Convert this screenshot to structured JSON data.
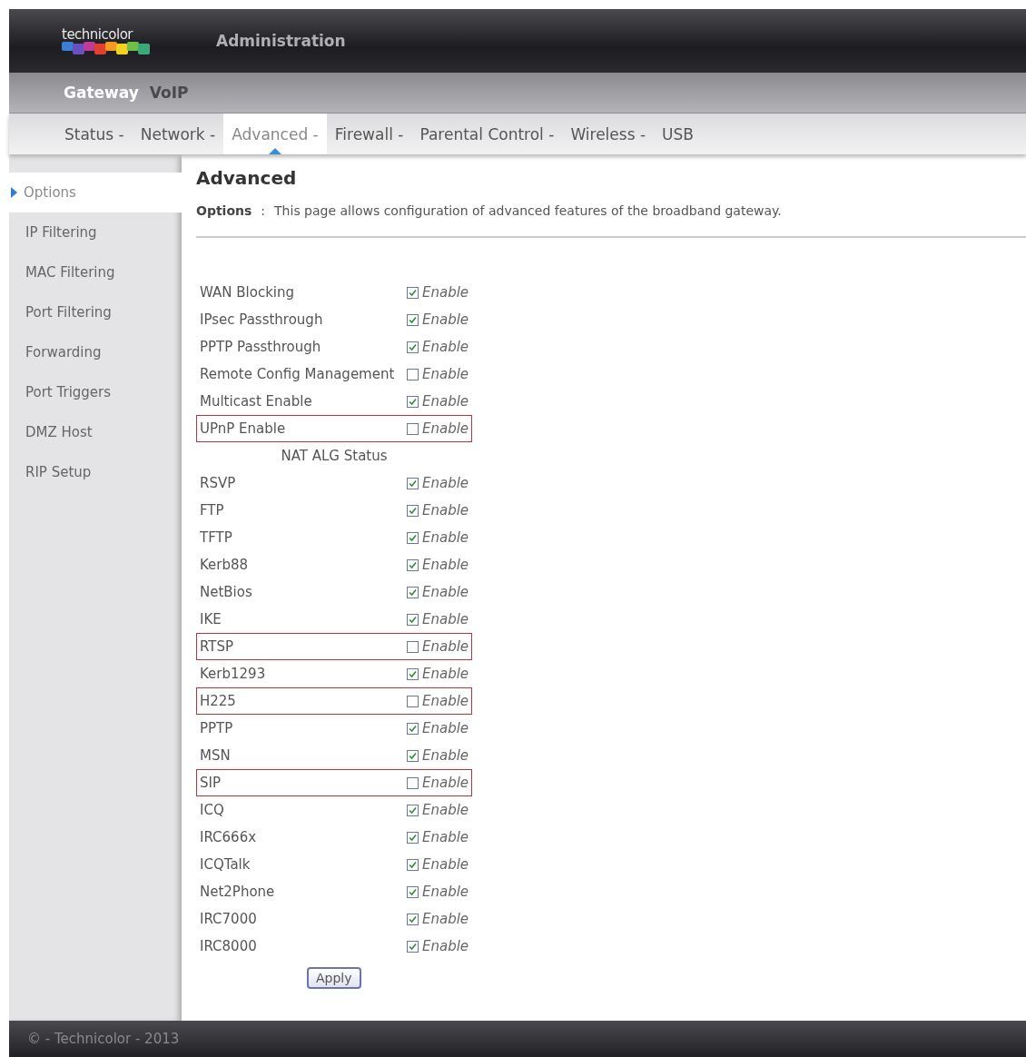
{
  "header": {
    "logo": "technicolor",
    "title": "Administration"
  },
  "subnav": [
    {
      "label": "Gateway",
      "selected": true
    },
    {
      "label": "VoIP",
      "selected": false
    }
  ],
  "tabs": [
    {
      "label": "Status -",
      "selected": false
    },
    {
      "label": "Network -",
      "selected": false
    },
    {
      "label": "Advanced -",
      "selected": true
    },
    {
      "label": "Firewall -",
      "selected": false
    },
    {
      "label": "Parental Control -",
      "selected": false
    },
    {
      "label": "Wireless -",
      "selected": false
    },
    {
      "label": "USB",
      "selected": false
    }
  ],
  "sidebar": {
    "items": [
      {
        "label": "Options",
        "selected": true
      },
      {
        "label": "IP Filtering",
        "selected": false
      },
      {
        "label": "MAC Filtering",
        "selected": false
      },
      {
        "label": "Port Filtering",
        "selected": false
      },
      {
        "label": "Forwarding",
        "selected": false
      },
      {
        "label": "Port Triggers",
        "selected": false
      },
      {
        "label": "DMZ Host",
        "selected": false
      },
      {
        "label": "RIP Setup",
        "selected": false
      }
    ]
  },
  "content": {
    "title": "Advanced",
    "intro_label": "Options",
    "intro_sep": ":",
    "intro": "This page allows configuration of advanced features of the broadband gateway.",
    "rows": [
      {
        "kind": "setting",
        "label": "WAN Blocking",
        "checked": true,
        "option": "Enable",
        "highlighted": false
      },
      {
        "kind": "setting",
        "label": "IPsec Passthrough",
        "checked": true,
        "option": "Enable",
        "highlighted": false
      },
      {
        "kind": "setting",
        "label": "PPTP Passthrough",
        "checked": true,
        "option": "Enable",
        "highlighted": false
      },
      {
        "kind": "setting",
        "label": "Remote Config Management",
        "checked": false,
        "option": "Enable",
        "highlighted": false
      },
      {
        "kind": "setting",
        "label": "Multicast Enable",
        "checked": true,
        "option": "Enable",
        "highlighted": false
      },
      {
        "kind": "setting",
        "label": "UPnP Enable",
        "checked": false,
        "option": "Enable",
        "highlighted": true
      },
      {
        "kind": "section",
        "label": "NAT ALG Status"
      },
      {
        "kind": "setting",
        "label": "RSVP",
        "checked": true,
        "option": "Enable",
        "highlighted": false
      },
      {
        "kind": "setting",
        "label": "FTP",
        "checked": true,
        "option": "Enable",
        "highlighted": false
      },
      {
        "kind": "setting",
        "label": "TFTP",
        "checked": true,
        "option": "Enable",
        "highlighted": false
      },
      {
        "kind": "setting",
        "label": "Kerb88",
        "checked": true,
        "option": "Enable",
        "highlighted": false
      },
      {
        "kind": "setting",
        "label": "NetBios",
        "checked": true,
        "option": "Enable",
        "highlighted": false
      },
      {
        "kind": "setting",
        "label": "IKE",
        "checked": true,
        "option": "Enable",
        "highlighted": false
      },
      {
        "kind": "setting",
        "label": "RTSP",
        "checked": false,
        "option": "Enable",
        "highlighted": true
      },
      {
        "kind": "setting",
        "label": "Kerb1293",
        "checked": true,
        "option": "Enable",
        "highlighted": false
      },
      {
        "kind": "setting",
        "label": "H225",
        "checked": false,
        "option": "Enable",
        "highlighted": true
      },
      {
        "kind": "setting",
        "label": "PPTP",
        "checked": true,
        "option": "Enable",
        "highlighted": false
      },
      {
        "kind": "setting",
        "label": "MSN",
        "checked": true,
        "option": "Enable",
        "highlighted": false
      },
      {
        "kind": "setting",
        "label": "SIP",
        "checked": false,
        "option": "Enable",
        "highlighted": true
      },
      {
        "kind": "setting",
        "label": "ICQ",
        "checked": true,
        "option": "Enable",
        "highlighted": false
      },
      {
        "kind": "setting",
        "label": "IRC666x",
        "checked": true,
        "option": "Enable",
        "highlighted": false
      },
      {
        "kind": "setting",
        "label": "ICQTalk",
        "checked": true,
        "option": "Enable",
        "highlighted": false
      },
      {
        "kind": "setting",
        "label": "Net2Phone",
        "checked": true,
        "option": "Enable",
        "highlighted": false
      },
      {
        "kind": "setting",
        "label": "IRC7000",
        "checked": true,
        "option": "Enable",
        "highlighted": false
      },
      {
        "kind": "setting",
        "label": "IRC8000",
        "checked": true,
        "option": "Enable",
        "highlighted": false
      }
    ],
    "apply_button": "Apply"
  },
  "footer": "© - Technicolor - 2013"
}
